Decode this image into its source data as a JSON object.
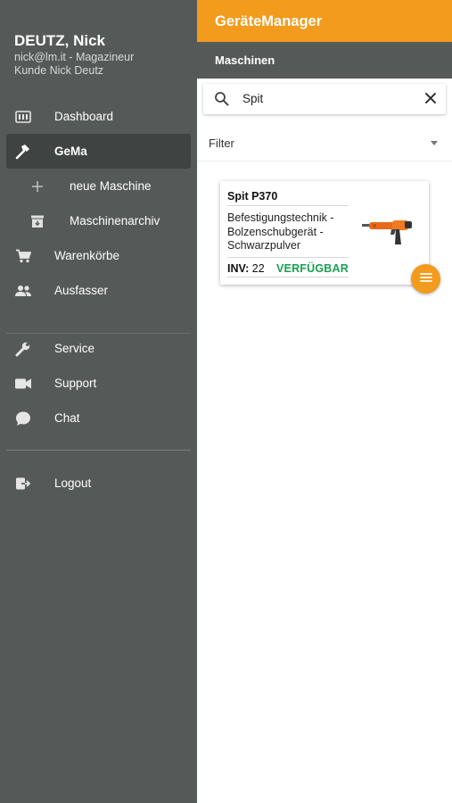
{
  "user": {
    "name": "DEUTZ, Nick",
    "email_role": "nick@lm.it - Magazineur",
    "client": "Kunde Nick Deutz"
  },
  "nav": {
    "dashboard": "Dashboard",
    "gema": "GeMa",
    "new_machine": "neue Maschine",
    "archive": "Maschinenarchiv",
    "carts": "Warenkörbe",
    "ausfasser": "Ausfasser",
    "service": "Service",
    "support": "Support",
    "chat": "Chat",
    "logout": "Logout"
  },
  "header": {
    "title": "GeräteManager",
    "subtitle": "Maschinen"
  },
  "search": {
    "value": "Spit"
  },
  "filter": {
    "label": "Filter"
  },
  "card": {
    "title": "Spit P370",
    "description": "Befestigungstechnik - Bolzenschubgerät - Schwarzpulver",
    "inv_label": "INV:",
    "inv_value": "22",
    "status": "VERFÜGBAR"
  },
  "colors": {
    "accent": "#f29b1d",
    "sidebar": "#555a59",
    "status_available": "#1aa053"
  }
}
